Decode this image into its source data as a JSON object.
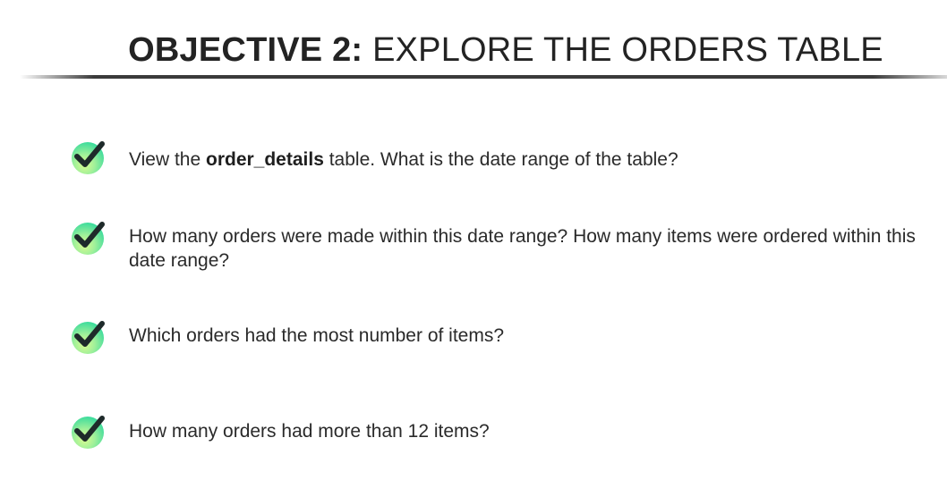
{
  "slide": {
    "title_bold": "OBJECTIVE 2:",
    "title_rest": "EXPLORE THE ORDERS TABLE",
    "items": [
      {
        "before": "View the ",
        "emphasis": "order_details",
        "after": " table. What is the date range of the table?",
        "icon": "check-icon"
      },
      {
        "before": "How many orders were made within this date range? How many items were ordered within this date range?",
        "emphasis": "",
        "after": "",
        "icon": "check-icon"
      },
      {
        "before": "Which orders had the most number of items?",
        "emphasis": "",
        "after": "",
        "icon": "check-icon"
      },
      {
        "before": "How many orders had more than 12 items?",
        "emphasis": "",
        "after": "",
        "icon": "check-icon"
      }
    ],
    "colors": {
      "check_disc_start": "#dafc8f",
      "check_disc_end": "#28c9a0",
      "check_mark": "#1e2a2a",
      "title_text": "#232323"
    }
  }
}
